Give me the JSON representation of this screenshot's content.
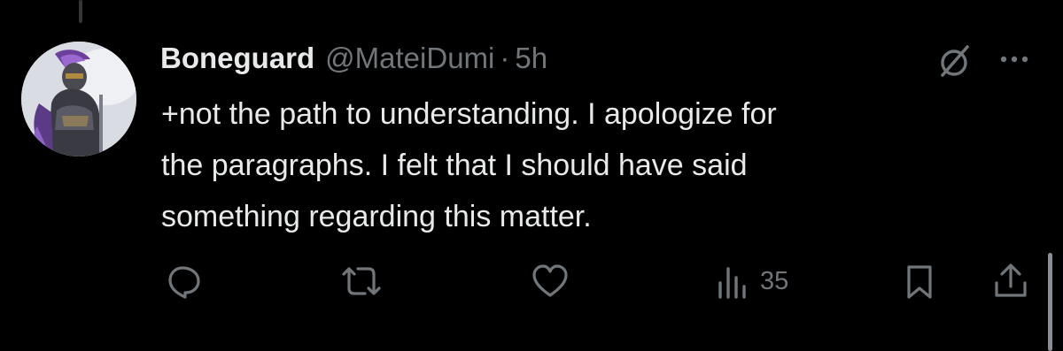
{
  "tweet": {
    "display_name": "Boneguard",
    "handle": "@MateiDumi",
    "separator": "·",
    "time": "5h",
    "text": "+not the path to understanding. I apologize for\nthe paragraphs. I felt that I should have said\nsomething regarding this matter."
  },
  "actions": {
    "reply": {
      "icon": "reply-icon"
    },
    "retweet": {
      "icon": "retweet-icon"
    },
    "like": {
      "icon": "heart-icon"
    },
    "views": {
      "icon": "views-icon",
      "count": "35"
    },
    "bookmark": {
      "icon": "bookmark-icon"
    },
    "share": {
      "icon": "share-icon"
    }
  },
  "colors": {
    "background": "#000000",
    "primary_text": "#e7e9ea",
    "secondary_text": "#71767b"
  }
}
